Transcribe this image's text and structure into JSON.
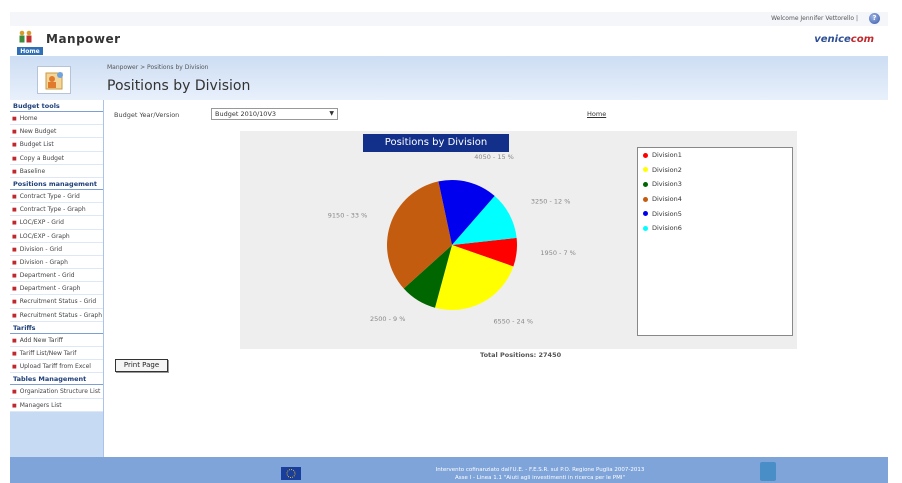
{
  "topbar": {
    "welcome": "Welcome Jennifer Vettorello |",
    "help_icon": "help-icon"
  },
  "header": {
    "app_title": "Manpower",
    "brand_main": "venice",
    "brand_accent": "com",
    "home_tab": "Home"
  },
  "band": {
    "breadcrumb": "Manpower > Positions by Division",
    "page_title": "Positions by Division"
  },
  "sidebar": {
    "sections": [
      {
        "title": "Budget tools",
        "items": [
          "Home",
          "New Budget",
          "Budget List",
          "Copy a Budget",
          "Baseline"
        ]
      },
      {
        "title": "Positions management",
        "items": [
          "Contract Type - Grid",
          "Contract Type - Graph",
          "LOC/EXP - Grid",
          "LOC/EXP - Graph",
          "Division - Grid",
          "Division - Graph",
          "Department - Grid",
          "Department - Graph",
          "Recruitment Status - Grid",
          "Recruitment Status - Graph"
        ]
      },
      {
        "title": "Tariffs",
        "items": [
          "Add New Tariff",
          "Tariff List/New Tarif",
          "Upload Tariff from Excel"
        ]
      },
      {
        "title": "Tables Management",
        "items": [
          "Organization Structure List",
          "Managers List"
        ]
      }
    ]
  },
  "filter": {
    "label": "Budget Year/Version",
    "selected": "Budget 2010/10V3",
    "home_link": "Home"
  },
  "chart_data": {
    "type": "pie",
    "title": "Positions by Division",
    "slices": [
      {
        "name": "Division1",
        "value": 1950,
        "percent": 7,
        "color": "#ff0000",
        "label": "1950 - 7 %"
      },
      {
        "name": "Division2",
        "value": 6550,
        "percent": 24,
        "color": "#ffff00",
        "label": "6550 - 24 %"
      },
      {
        "name": "Division3",
        "value": 2500,
        "percent": 9,
        "color": "#006600",
        "label": "2500 - 9 %"
      },
      {
        "name": "Division4",
        "value": 9150,
        "percent": 33,
        "color": "#c45c10",
        "label": "9150 - 33 %"
      },
      {
        "name": "Division5",
        "value": 4050,
        "percent": 15,
        "color": "#0000ee",
        "label": "4050 - 15 %"
      },
      {
        "name": "Division6",
        "value": 3250,
        "percent": 12,
        "color": "#00ffff",
        "label": "3250 - 12 %"
      }
    ],
    "legend_position": "right"
  },
  "total_label": "Total Positions: 27450",
  "print_button": "Print Page",
  "footer": {
    "line1": "Intervento cofinanziato dall'U.E. - F.E.S.R. sul P.O. Regione Puglia 2007-2013",
    "line2": "Asse I - Linea 1.1 \"Aiuti agli investimenti in ricerca per le PMI\""
  }
}
